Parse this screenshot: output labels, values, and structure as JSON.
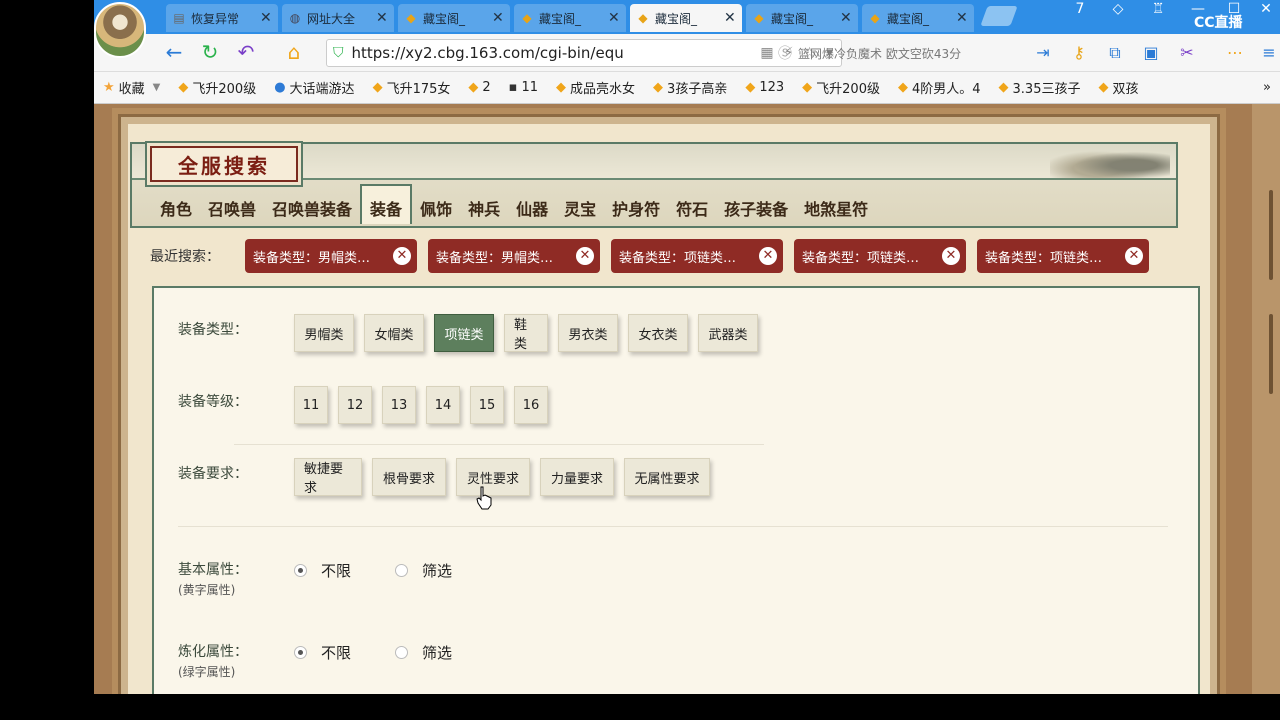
{
  "browser": {
    "tabs": [
      {
        "label": "恢复异常",
        "icon": "page-icon",
        "active": false
      },
      {
        "label": "网址大全",
        "icon": "globe-icon",
        "active": false
      },
      {
        "label": "藏宝阁_",
        "icon": "cbg-icon",
        "active": false
      },
      {
        "label": "藏宝阁_",
        "icon": "cbg-icon",
        "active": false
      },
      {
        "label": "藏宝阁_",
        "icon": "cbg-icon",
        "active": true
      },
      {
        "label": "藏宝阁_",
        "icon": "cbg-icon",
        "active": false
      },
      {
        "label": "藏宝阁_",
        "icon": "cbg-icon",
        "active": false
      }
    ],
    "tab_close": "✕",
    "cc_label": "CC直播",
    "window_controls": {
      "help": "7",
      "minimize": "—",
      "maximize": "☐",
      "close": "✕"
    },
    "url": "https://xy2.cbg.163.com/cgi-bin/equ",
    "search_text": "篮网爆冷负魔术 欧文空砍43分",
    "bookmarks": [
      {
        "label": "收藏",
        "icon": "star-icon",
        "dropdown": true
      },
      {
        "label": "飞升200级",
        "icon": "cbg-icon"
      },
      {
        "label": "大话端游达",
        "icon": "game-icon"
      },
      {
        "label": "飞升175女",
        "icon": "cbg-icon"
      },
      {
        "label": "2",
        "icon": "cbg-icon"
      },
      {
        "label": "11",
        "icon": "dark-icon"
      },
      {
        "label": "成品亮水女",
        "icon": "cbg-icon"
      },
      {
        "label": "3孩子高亲",
        "icon": "cbg-icon"
      },
      {
        "label": "123",
        "icon": "cbg-icon"
      },
      {
        "label": "飞升200级",
        "icon": "cbg-icon"
      },
      {
        "label": "4阶男人。4",
        "icon": "cbg-icon"
      },
      {
        "label": "3.35三孩子",
        "icon": "cbg-icon"
      },
      {
        "label": "双孩",
        "icon": "cbg-icon"
      }
    ],
    "bookmarks_more": "»"
  },
  "page": {
    "title": "全服搜索",
    "nav": [
      {
        "label": "角色",
        "active": false
      },
      {
        "label": "召唤兽",
        "active": false
      },
      {
        "label": "召唤兽装备",
        "active": false
      },
      {
        "label": "装备",
        "active": true
      },
      {
        "label": "佩饰",
        "active": false
      },
      {
        "label": "神兵",
        "active": false
      },
      {
        "label": "仙器",
        "active": false
      },
      {
        "label": "灵宝",
        "active": false
      },
      {
        "label": "护身符",
        "active": false
      },
      {
        "label": "符石",
        "active": false
      },
      {
        "label": "孩子装备",
        "active": false
      },
      {
        "label": "地煞星符",
        "active": false
      }
    ],
    "recent_label": "最近搜索：",
    "recent_chips": [
      "装备类型：男帽类…",
      "装备类型：男帽类…",
      "装备类型：项链类…",
      "装备类型：项链类…",
      "装备类型：项链类…"
    ],
    "filters": {
      "type": {
        "label": "装备类型：",
        "options": [
          "男帽类",
          "女帽类",
          "项链类",
          "鞋类",
          "男衣类",
          "女衣类",
          "武器类"
        ],
        "selected": "项链类"
      },
      "level": {
        "label": "装备等级：",
        "options": [
          "11",
          "12",
          "13",
          "14",
          "15",
          "16"
        ]
      },
      "requirement": {
        "label": "装备要求：",
        "options": [
          "敏捷要求",
          "根骨要求",
          "灵性要求",
          "力量要求",
          "无属性要求"
        ]
      },
      "basic": {
        "label": "基本属性：",
        "sublabel": "(黄字属性)",
        "options": [
          "不限",
          "筛选"
        ],
        "selected": "不限"
      },
      "refine": {
        "label": "炼化属性：",
        "sublabel": "(绿字属性)",
        "options": [
          "不限",
          "筛选"
        ],
        "selected": "不限"
      }
    }
  },
  "colors": {
    "accent_red": "#8f2b25",
    "selected_green": "#5d7f5d",
    "tabbar_blue": "#2f8ee6"
  }
}
